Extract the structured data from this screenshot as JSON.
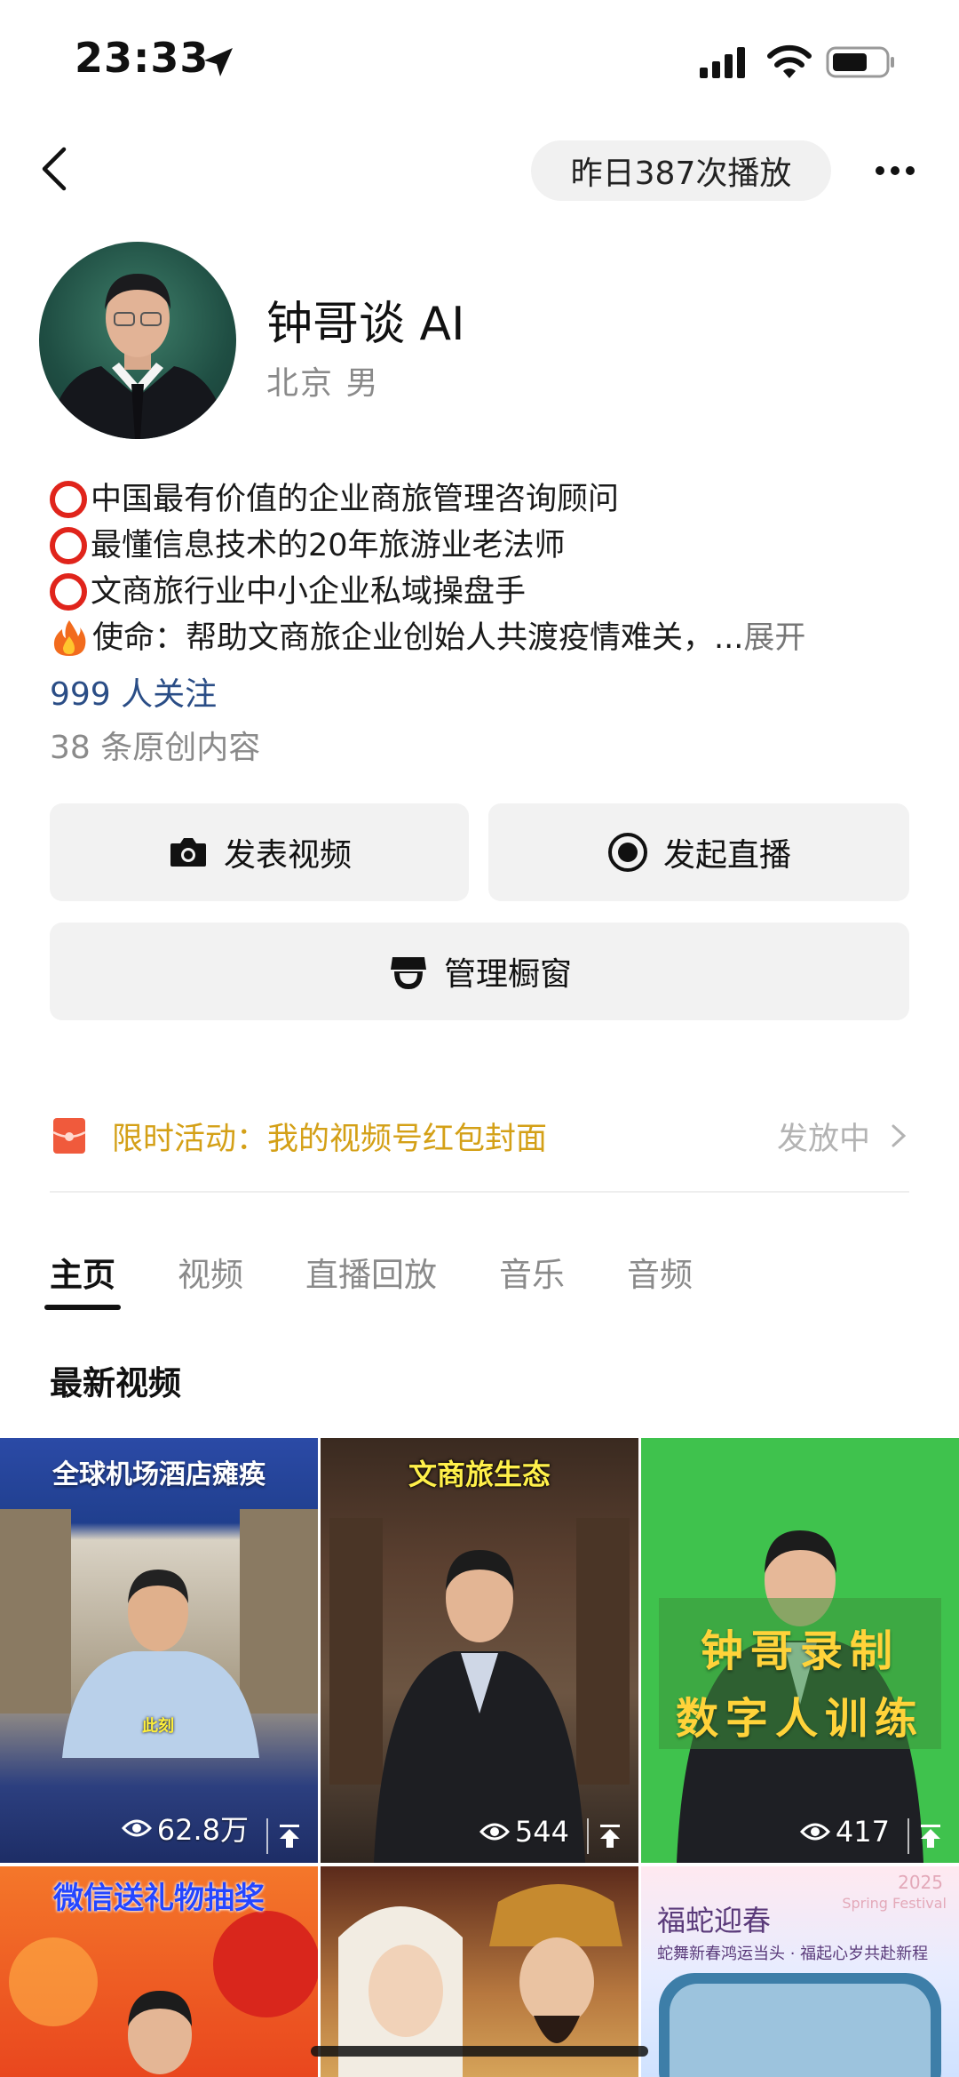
{
  "status_bar": {
    "time": "23:33"
  },
  "header": {
    "plays_text": "昨日387次播放"
  },
  "profile": {
    "name": "钟哥谈 AI",
    "meta": "北京 男",
    "bio": [
      "中国最有价值的企业商旅管理咨询顾问",
      "最懂信息技术的20年旅游业老法师",
      "文商旅行业中小企业私域操盘手"
    ],
    "mission": "使命：帮助文商旅企业创始人共渡疫情难关，...",
    "expand_label": "展开",
    "followers": "999 人关注",
    "originals": "38 条原创内容"
  },
  "actions": {
    "post_video": "发表视频",
    "start_live": "发起直播",
    "manage_shop": "管理橱窗"
  },
  "activity": {
    "title": "限时活动：我的视频号红包封面",
    "status": "发放中"
  },
  "tabs": [
    "主页",
    "视频",
    "直播回放",
    "音乐",
    "音频"
  ],
  "section_title": "最新视频",
  "videos": [
    {
      "caption": "全球机场酒店瘫痪",
      "subtitle": "此刻",
      "views": "62.8万"
    },
    {
      "caption": "文商旅生态",
      "views": "544"
    },
    {
      "caption_line1": "钟哥录制",
      "caption_line2": "数字人训练",
      "views": "417"
    },
    {
      "caption": "微信送礼物抽奖"
    },
    {},
    {
      "caption": "福蛇迎春",
      "subcaption": "蛇舞新春鸿运当头 · 福起心岁共赴新程",
      "year": "2025",
      "year_sub": "Spring Festival"
    }
  ],
  "colors": {
    "accent_gold": "#d4a017",
    "link_blue": "#2a4d86",
    "red_ring": "#e0241b",
    "button_bg": "#f2f2f2"
  }
}
